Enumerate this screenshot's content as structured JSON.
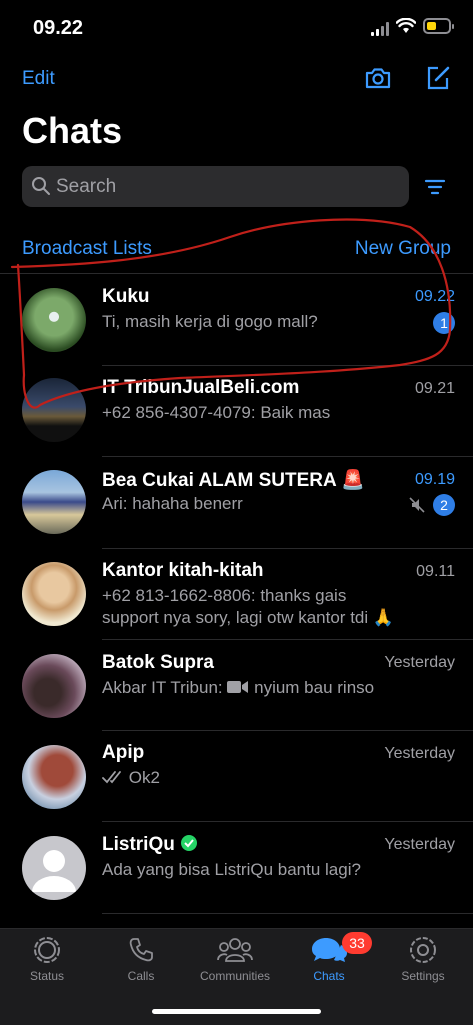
{
  "status": {
    "time": "09.22"
  },
  "header": {
    "edit_label": "Edit",
    "title": "Chats"
  },
  "search": {
    "placeholder": "Search"
  },
  "links": {
    "broadcast": "Broadcast Lists",
    "new_group": "New Group"
  },
  "chats": [
    {
      "name": "Kuku",
      "time": "09.22",
      "message": "Ti, masih kerja di gogo mall?",
      "unread": "1"
    },
    {
      "name": "IT TribunJualBeli.com",
      "time": "09.21",
      "message": "+62 856-4307-4079: Baik mas"
    },
    {
      "name": "Bea Cukai ALAM SUTERA",
      "emoji": "🚨",
      "time": "09.19",
      "message": "Ari: hahaha benerr",
      "unread": "2"
    },
    {
      "name": "Kantor kitah-kitah",
      "time": "09.11",
      "message_line1": "+62 813-1662-8806: thanks gais",
      "message_line2": "support nya sory, lagi otw kantor tdi 🙏"
    },
    {
      "name": "Batok Supra",
      "time": "Yesterday",
      "message_prefix": "Akbar IT Tribun:",
      "message": "nyium bau rinso"
    },
    {
      "name": "Apip",
      "time": "Yesterday",
      "message": "Ok2"
    },
    {
      "name": "ListriQu",
      "time": "Yesterday",
      "message": "Ada yang bisa ListriQu bantu lagi?"
    }
  ],
  "tabs": [
    {
      "label": "Status",
      "icon": "status-icon"
    },
    {
      "label": "Calls",
      "icon": "phone-icon"
    },
    {
      "label": "Communities",
      "icon": "communities-icon"
    },
    {
      "label": "Chats",
      "icon": "chat-bubbles-icon",
      "badge": "33"
    },
    {
      "label": "Settings",
      "icon": "gear-icon"
    }
  ],
  "colors": {
    "accent": "#3d9bff",
    "badge": "#ff3b30",
    "background": "#000000"
  }
}
